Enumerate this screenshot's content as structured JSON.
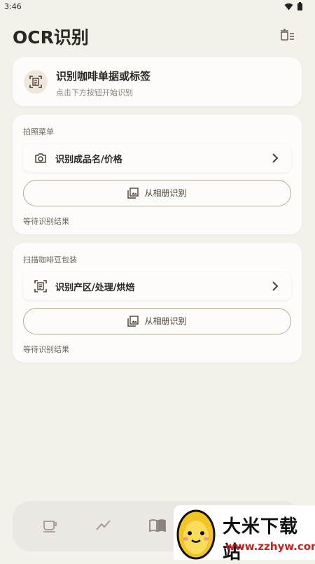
{
  "status_bar": {
    "time": "3:46",
    "icons": [
      "wifi-icon",
      "battery-icon"
    ]
  },
  "header": {
    "title": "OCR识别",
    "action_icon": "delete-list-icon"
  },
  "intro_card": {
    "icon": "scan-document-icon",
    "title": "识别咖啡单据或标签",
    "subtitle": "点击下方按钮开始识别"
  },
  "sections": [
    {
      "label": "拍照菜单",
      "row": {
        "icon": "camera-icon",
        "label": "识别成品名/价格"
      },
      "button": {
        "icon": "gallery-icon",
        "label": "从相册识别"
      },
      "result": "等待识别结果"
    },
    {
      "label": "扫描咖啡豆包装",
      "row": {
        "icon": "scan-document-icon",
        "label": "识别产区/处理/烘焙"
      },
      "button": {
        "icon": "gallery-icon",
        "label": "从相册识别"
      },
      "result": "等待识别结果"
    }
  ],
  "bottom_nav": {
    "items": [
      "coffee-cup-icon",
      "trend-chart-icon",
      "book-icon"
    ]
  },
  "watermark": {
    "title": "大米下载站",
    "url": "www.zzhyw.com"
  },
  "colors": {
    "background": "#f4f0ea",
    "card": "#fdfcfa",
    "accent_brown": "#4d3f31",
    "outline": "#b9aa96"
  }
}
